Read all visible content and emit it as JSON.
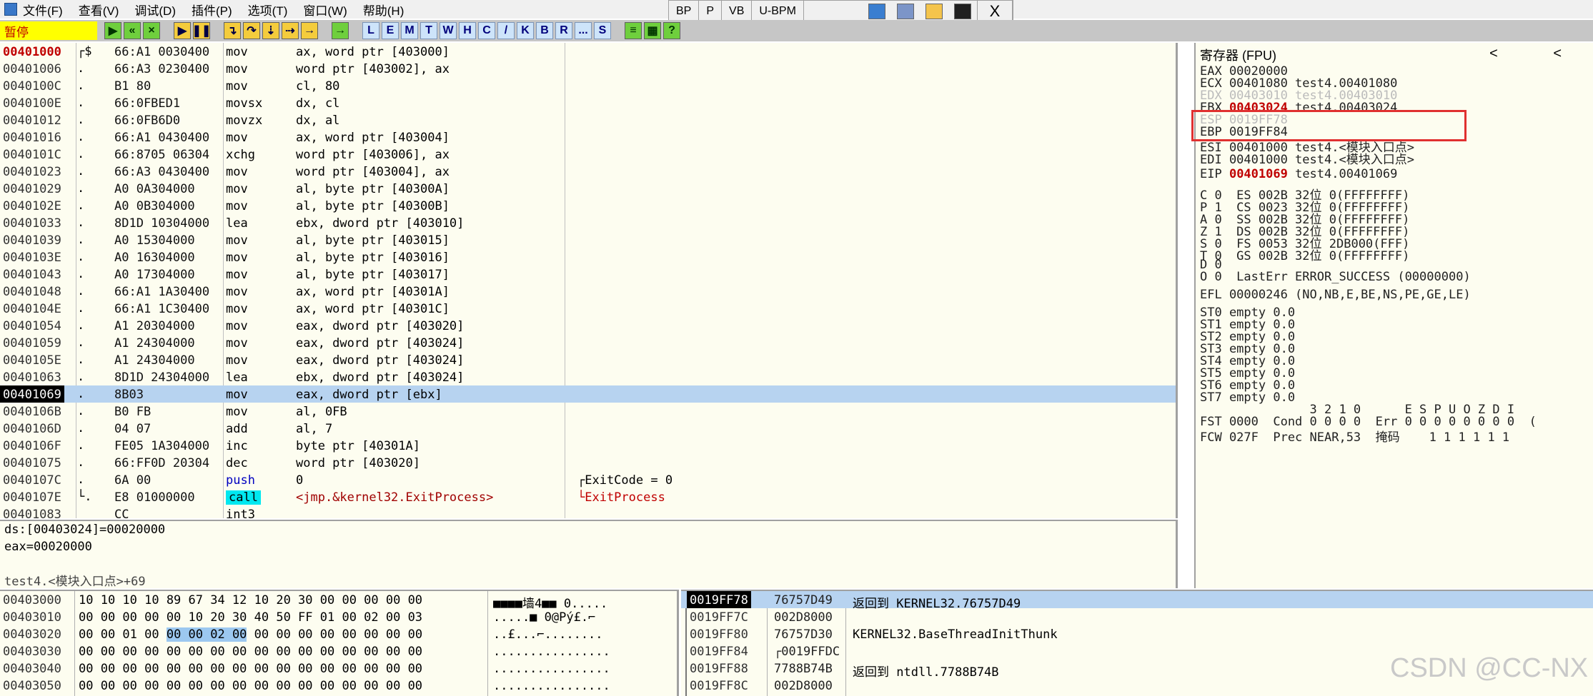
{
  "menu": {
    "items": [
      "文件(F)",
      "查看(V)",
      "调试(D)",
      "插件(P)",
      "选项(T)",
      "窗口(W)",
      "帮助(H)"
    ],
    "buttons": [
      "BP",
      "P",
      "VB",
      "U-BPM"
    ],
    "close": "X"
  },
  "toolbar": {
    "status": "暂停",
    "letters": [
      "L",
      "E",
      "M",
      "T",
      "W",
      "H",
      "C",
      "/",
      "K",
      "B",
      "R",
      "...",
      "S"
    ]
  },
  "disasm": {
    "rows": [
      {
        "addr": "00401000",
        "br": "┌$",
        "hex": "66:A1 0030400",
        "mnem": "mov",
        "ops": "ax, word ptr [403000]",
        "comment": ""
      },
      {
        "addr": "00401006",
        "br": ".",
        "hex": "66:A3 0230400",
        "mnem": "mov",
        "ops": "word ptr [403002], ax",
        "comment": ""
      },
      {
        "addr": "0040100C",
        "br": ".",
        "hex": "B1 80",
        "mnem": "mov",
        "ops": "cl, 80",
        "comment": ""
      },
      {
        "addr": "0040100E",
        "br": ".",
        "hex": "66:0FBED1",
        "mnem": "movsx",
        "ops": "dx, cl",
        "comment": ""
      },
      {
        "addr": "00401012",
        "br": ".",
        "hex": "66:0FB6D0",
        "mnem": "movzx",
        "ops": "dx, al",
        "comment": ""
      },
      {
        "addr": "00401016",
        "br": ".",
        "hex": "66:A1 0430400",
        "mnem": "mov",
        "ops": "ax, word ptr [403004]",
        "comment": ""
      },
      {
        "addr": "0040101C",
        "br": ".",
        "hex": "66:8705 06304",
        "mnem": "xchg",
        "ops": "word ptr [403006], ax",
        "comment": ""
      },
      {
        "addr": "00401023",
        "br": ".",
        "hex": "66:A3 0430400",
        "mnem": "mov",
        "ops": "word ptr [403004], ax",
        "comment": ""
      },
      {
        "addr": "00401029",
        "br": ".",
        "hex": "A0 0A304000",
        "mnem": "mov",
        "ops": "al, byte ptr [40300A]",
        "comment": ""
      },
      {
        "addr": "0040102E",
        "br": ".",
        "hex": "A0 0B304000",
        "mnem": "mov",
        "ops": "al, byte ptr [40300B]",
        "comment": ""
      },
      {
        "addr": "00401033",
        "br": ".",
        "hex": "8D1D 10304000",
        "mnem": "lea",
        "ops": "ebx, dword ptr [403010]",
        "comment": ""
      },
      {
        "addr": "00401039",
        "br": ".",
        "hex": "A0 15304000",
        "mnem": "mov",
        "ops": "al, byte ptr [403015]",
        "comment": ""
      },
      {
        "addr": "0040103E",
        "br": ".",
        "hex": "A0 16304000",
        "mnem": "mov",
        "ops": "al, byte ptr [403016]",
        "comment": ""
      },
      {
        "addr": "00401043",
        "br": ".",
        "hex": "A0 17304000",
        "mnem": "mov",
        "ops": "al, byte ptr [403017]",
        "comment": ""
      },
      {
        "addr": "00401048",
        "br": ".",
        "hex": "66:A1 1A30400",
        "mnem": "mov",
        "ops": "ax, word ptr [40301A]",
        "comment": ""
      },
      {
        "addr": "0040104E",
        "br": ".",
        "hex": "66:A1 1C30400",
        "mnem": "mov",
        "ops": "ax, word ptr [40301C]",
        "comment": ""
      },
      {
        "addr": "00401054",
        "br": ".",
        "hex": "A1 20304000",
        "mnem": "mov",
        "ops": "eax, dword ptr [403020]",
        "comment": ""
      },
      {
        "addr": "00401059",
        "br": ".",
        "hex": "A1 24304000",
        "mnem": "mov",
        "ops": "eax, dword ptr [403024]",
        "comment": ""
      },
      {
        "addr": "0040105E",
        "br": ".",
        "hex": "A1 24304000",
        "mnem": "mov",
        "ops": "eax, dword ptr [403024]",
        "comment": ""
      },
      {
        "addr": "00401063",
        "br": ".",
        "hex": "8D1D 24304000",
        "mnem": "lea",
        "ops": "ebx, dword ptr [403024]",
        "comment": ""
      },
      {
        "addr": "00401069",
        "br": ".",
        "hex": "8B03",
        "mnem": "mov",
        "ops": "eax, dword ptr [ebx]",
        "comment": ""
      },
      {
        "addr": "0040106B",
        "br": ".",
        "hex": "B0 FB",
        "mnem": "mov",
        "ops": "al, 0FB",
        "comment": ""
      },
      {
        "addr": "0040106D",
        "br": ".",
        "hex": "04 07",
        "mnem": "add",
        "ops": "al, 7",
        "comment": ""
      },
      {
        "addr": "0040106F",
        "br": ".",
        "hex": "FE05 1A304000",
        "mnem": "inc",
        "ops": "byte ptr [40301A]",
        "comment": ""
      },
      {
        "addr": "00401075",
        "br": ".",
        "hex": "66:FF0D 20304",
        "mnem": "dec",
        "ops": "word ptr [403020]",
        "comment": ""
      },
      {
        "addr": "0040107C",
        "br": ".",
        "hex": "6A 00",
        "mnem": "push",
        "ops": "0",
        "comment": "┌ExitCode = 0"
      },
      {
        "addr": "0040107E",
        "br": "└.",
        "hex": "E8 01000000",
        "mnem": "call",
        "ops": "<jmp.&kernel32.ExitProcess>",
        "comment": "└ExitProcess"
      },
      {
        "addr": "00401083",
        "br": "",
        "hex": "CC",
        "mnem": "int3",
        "ops": "",
        "comment": ""
      }
    ]
  },
  "info": {
    "line1": "ds:[00403024]=00020000",
    "line2": "eax=00020000",
    "line3": "test4.<模块入口点>+69"
  },
  "registers": {
    "title": "寄存器 (FPU)",
    "nav": "< <",
    "lines": [
      "EAX 00020000",
      "ECX 00401080 test4.00401080",
      "EDX 00403010 test4.00403010",
      "EBX 00403024 test4.00403024",
      "ESP 0019FF78",
      "EBP 0019FF84",
      "ESI 00401000 test4.<模块入口点>",
      "EDI 00401000 test4.<模块入口点>",
      "EIP 00401069 test4.00401069",
      "C 0  ES 002B 32位 0(FFFFFFFF)",
      "P 1  CS 0023 32位 0(FFFFFFFF)",
      "A 0  SS 002B 32位 0(FFFFFFFF)",
      "Z 1  DS 002B 32位 0(FFFFFFFF)",
      "S 0  FS 0053 32位 2DB000(FFF)",
      "T 0  GS 002B 32位 0(FFFFFFFF)",
      "D 0",
      "O 0  LastErr ERROR_SUCCESS (00000000)",
      "EFL 00000246 (NO,NB,E,BE,NS,PE,GE,LE)",
      "ST0 empty 0.0",
      "ST1 empty 0.0",
      "ST2 empty 0.0",
      "ST3 empty 0.0",
      "ST4 empty 0.0",
      "ST5 empty 0.0",
      "ST6 empty 0.0",
      "ST7 empty 0.0",
      "               3 2 1 0      E S P U O Z D I",
      "FST 0000  Cond 0 0 0 0  Err 0 0 0 0 0 0 0 0  (",
      "FCW 027F  Prec NEAR,53  掩码    1 1 1 1 1 1"
    ],
    "ebx_value": "00403024",
    "eip_value": "00401069"
  },
  "dump": {
    "rows": [
      {
        "addr": "00403000",
        "hex": "10 10 10 10 89 67 34 12 10 20 30 00 00 00 00 00",
        "ascii": "■■■■墙4■■ 0....."
      },
      {
        "addr": "00403010",
        "hex": "00 00 00 00 00 10 20 30 40 50 FF 01 00 02 00 03",
        "ascii": ".....■ 0@Pý£.⌐"
      },
      {
        "addr": "00403020",
        "hex": "00 00 01 00 00 00 02 00 00 00 00 00 00 00 00 00",
        "ascii": "..£...⌐........"
      },
      {
        "addr": "00403030",
        "hex": "00 00 00 00 00 00 00 00 00 00 00 00 00 00 00 00",
        "ascii": "................"
      },
      {
        "addr": "00403040",
        "hex": "00 00 00 00 00 00 00 00 00 00 00 00 00 00 00 00",
        "ascii": "................"
      },
      {
        "addr": "00403050",
        "hex": "00 00 00 00 00 00 00 00 00 00 00 00 00 00 00 00",
        "ascii": "................"
      }
    ]
  },
  "stack": {
    "rows": [
      {
        "addr": "0019FF78",
        "val": "76757D49",
        "comment": "返回到 KERNEL32.76757D49"
      },
      {
        "addr": "0019FF7C",
        "val": "002D8000",
        "comment": ""
      },
      {
        "addr": "0019FF80",
        "val": "76757D30",
        "comment": "KERNEL32.BaseThreadInitThunk"
      },
      {
        "addr": "0019FF84",
        "val": "┌0019FFDC",
        "comment": ""
      },
      {
        "addr": "0019FF88",
        "val": "7788B74B",
        "comment": "返回到 ntdll.7788B74B"
      },
      {
        "addr": "0019FF8C",
        "val": "002D8000",
        "comment": ""
      }
    ]
  },
  "watermark": "CSDN @CC-NX",
  "colors": {
    "highlight": "#b7d3f0",
    "red": "#c00000",
    "callbg": "#00e8f0",
    "annot": "#e03030"
  }
}
